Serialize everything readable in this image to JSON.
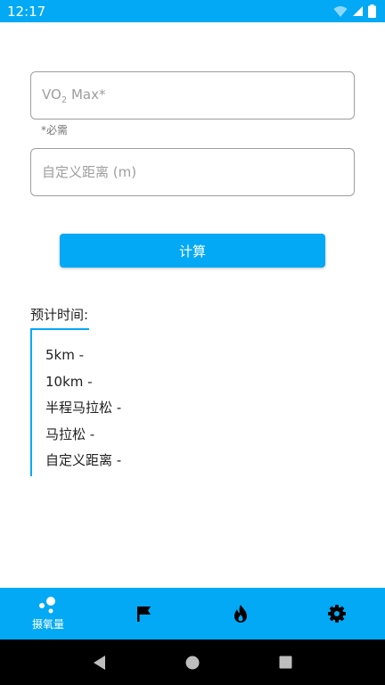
{
  "status_bar": {
    "time": "12:17",
    "icons": [
      "wifi-icon",
      "signal-icon",
      "battery-icon"
    ]
  },
  "form": {
    "vo2_label_main": "VO",
    "vo2_label_sub": "2",
    "vo2_label_rest": " Max*",
    "required_helper": "*必需",
    "distance_placeholder": "自定义距离 (m)"
  },
  "calculate_button": "计算",
  "results": {
    "title": "预计时间:",
    "items": [
      "5km -",
      "10km -",
      "半程马拉松 -",
      "马拉松 -",
      "自定义距离 -"
    ]
  },
  "bottom_nav": {
    "items": [
      {
        "icon": "molecule-icon",
        "label": "摄氧量",
        "active": true
      },
      {
        "icon": "flag-icon",
        "label": ""
      },
      {
        "icon": "fire-icon",
        "label": ""
      },
      {
        "icon": "gear-icon",
        "label": ""
      }
    ]
  },
  "system_nav": [
    "back-icon",
    "home-icon",
    "recents-icon"
  ],
  "colors": {
    "accent": "#03a9f4",
    "border": "#9e9e9e",
    "text": "#212121"
  }
}
